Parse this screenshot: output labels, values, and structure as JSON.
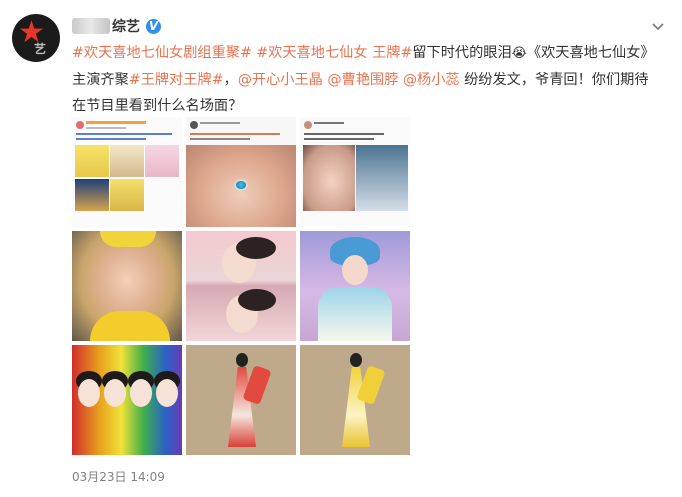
{
  "account": {
    "name": "综艺",
    "verified_mark": "V",
    "avatar_text": "艺"
  },
  "post": {
    "segments": [
      {
        "text": "#欢天喜地七仙女剧组重聚#",
        "type": "link"
      },
      {
        "text": " ",
        "type": "plain"
      },
      {
        "text": "#欢天喜地七仙女 王牌#",
        "type": "link"
      },
      {
        "text": "留下时代的眼泪",
        "type": "plain"
      },
      {
        "text": "😭",
        "type": "emoji"
      },
      {
        "text": "《欢天喜地七仙女》",
        "type": "plain"
      },
      {
        "text": "主演齐聚",
        "type": "plain"
      },
      {
        "text": "#王牌对王牌#",
        "type": "link"
      },
      {
        "text": "，",
        "type": "plain"
      },
      {
        "text": "@开心小王晶",
        "type": "link"
      },
      {
        "text": " ",
        "type": "plain"
      },
      {
        "text": "@曹艳围脖",
        "type": "link"
      },
      {
        "text": " ",
        "type": "plain"
      },
      {
        "text": "@杨小蕊",
        "type": "link"
      },
      {
        "text": " 纷纷发文，爷青回！你们期待在节目里看到什么名场面？",
        "type": "plain"
      }
    ]
  },
  "images": [
    {
      "name": "screenshot-post-1"
    },
    {
      "name": "screenshot-post-2"
    },
    {
      "name": "screenshot-post-3"
    },
    {
      "name": "selfie-yellow-costume"
    },
    {
      "name": "pink-fairy-stills"
    },
    {
      "name": "blue-fairy-still"
    },
    {
      "name": "seven-fairies-poster"
    },
    {
      "name": "red-fairy-illustration"
    },
    {
      "name": "yellow-fairy-illustration"
    }
  ],
  "meta": {
    "timestamp": "03月23日 14:09"
  },
  "icons": {
    "more": "chevron-down-icon",
    "verified": "verified-badge-icon"
  },
  "colors": {
    "link": "#eb7350",
    "verified": "#2e8ff0",
    "text": "#333333",
    "timestamp": "#808080"
  }
}
